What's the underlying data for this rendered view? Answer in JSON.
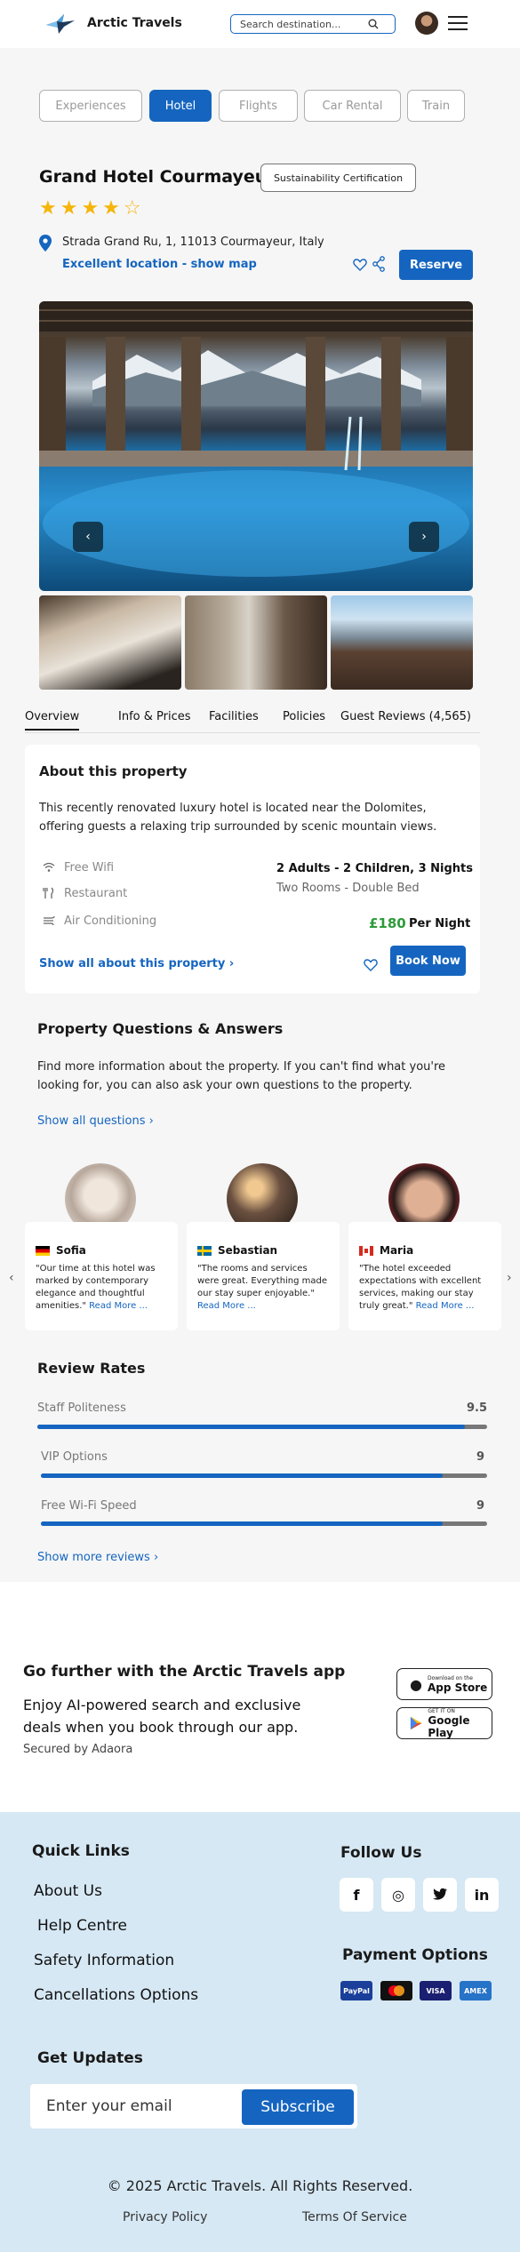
{
  "header": {
    "brand": "Arctic Travels",
    "search_placeholder": "Search destination...",
    "logo_icon": "arctic-bird-logo-icon",
    "search_icon": "search-icon",
    "menu_icon": "hamburger-icon"
  },
  "tabs": [
    {
      "label": "Experiences",
      "active": false
    },
    {
      "label": "Hotel",
      "active": true
    },
    {
      "label": "Flights",
      "active": false
    },
    {
      "label": "Car Rental",
      "active": false
    },
    {
      "label": "Train",
      "active": false
    }
  ],
  "hotel": {
    "name": "Grand Hotel Courmayeur",
    "certification": "Sustainability Certification",
    "stars_filled": 4,
    "stars_total": 5,
    "stars_display": "★★★★☆",
    "address": "Strada Grand Ru, 1, 11013 Courmayeur, Italy",
    "location_link": "Excellent location - show map",
    "reserve_label": "Reserve"
  },
  "gallery": {
    "prev": "‹",
    "next": "›"
  },
  "overview_nav": [
    {
      "label": "Overview",
      "active": true
    },
    {
      "label": "Info & Prices",
      "active": false
    },
    {
      "label": "Facilities",
      "active": false
    },
    {
      "label": "Policies",
      "active": false
    },
    {
      "label": "Guest Reviews (4,565)",
      "active": false
    }
  ],
  "about": {
    "title": "About this property",
    "description": "This recently renovated luxury hotel is located near the Dolomites, offering guests a relaxing trip surrounded by scenic mountain views.",
    "amenities": [
      {
        "label": "Free Wifi",
        "icon": "wifi-icon"
      },
      {
        "label": "Restaurant",
        "icon": "restaurant-icon"
      },
      {
        "label": "Air Conditioning",
        "icon": "air-conditioning-icon"
      }
    ],
    "guests": "2 Adults - 2 Children, 3 Nights",
    "rooms": "Two Rooms - Double Bed",
    "price": "£180",
    "per_night": "Per Night",
    "show_all": "Show all about this property",
    "book_label": "Book Now"
  },
  "questions": {
    "title": "Property Questions & Answers",
    "description": "Find more information about the property. If you can't find what you're looking for, you can also ask your own questions to the property.",
    "link": "Show all questions"
  },
  "reviews": [
    {
      "name": "Sofia",
      "flag": "germany-flag",
      "text": "\"Our time at this hotel was marked by contemporary elegance and thoughtful amenities.\"",
      "more": "Read More ..."
    },
    {
      "name": "Sebastian",
      "flag": "sweden-flag",
      "text": "\"The rooms and services were great. Everything made our stay super enjoyable.\"",
      "more": "Read More ..."
    },
    {
      "name": "Maria",
      "flag": "canada-flag",
      "text": "\"The hotel exceeded expectations with excellent services, making our stay truly great.\"",
      "more": "Read More ..."
    }
  ],
  "review_rates": {
    "title": "Review Rates",
    "items": [
      {
        "label": "Staff Politeness",
        "value": "9.5",
        "fraction": 0.95
      },
      {
        "label": "VIP Options",
        "value": "9",
        "fraction": 0.9
      },
      {
        "label": "Free Wi-Fi Speed",
        "value": "9",
        "fraction": 0.9
      }
    ],
    "more_link": "Show more reviews"
  },
  "app": {
    "title": "Go further with the Arctic Travels app",
    "description": "Enjoy AI-powered search and exclusive deals when you book through our app.",
    "secured": "Secured by Adaora",
    "appstore_small": "Download on the",
    "appstore_big": "App Store",
    "googleplay_small": "GET IT ON",
    "googleplay_big": "Google Play"
  },
  "footer": {
    "quick_links_title": "Quick Links",
    "quick_links": [
      "About Us",
      "Help Centre",
      "Safety Information",
      "Cancellations Options"
    ],
    "follow_title": "Follow Us",
    "social": [
      {
        "label": "f",
        "icon": "facebook-icon"
      },
      {
        "label": "◎",
        "icon": "instagram-icon"
      },
      {
        "label": "🐦",
        "icon": "twitter-icon"
      },
      {
        "label": "in",
        "icon": "linkedin-icon"
      }
    ],
    "payment_title": "Payment Options",
    "payments": [
      {
        "label": "PayPal",
        "color": "#1a3f9a"
      },
      {
        "label": "MC",
        "color": "#111111"
      },
      {
        "label": "VISA",
        "color": "#1a1f71"
      },
      {
        "label": "AMEX",
        "color": "#2673c8"
      }
    ],
    "updates_title": "Get Updates",
    "email_placeholder": "Enter your email",
    "subscribe_label": "Subscribe",
    "copyright": "© 2025 Arctic Travels. All Rights Reserved.",
    "privacy": "Privacy Policy",
    "terms": "Terms Of Service"
  },
  "colors": {
    "accent": "#1565c0",
    "price_green": "#2e9b3a",
    "star": "#f5b50a",
    "footer_bg": "#d6e8f4"
  }
}
